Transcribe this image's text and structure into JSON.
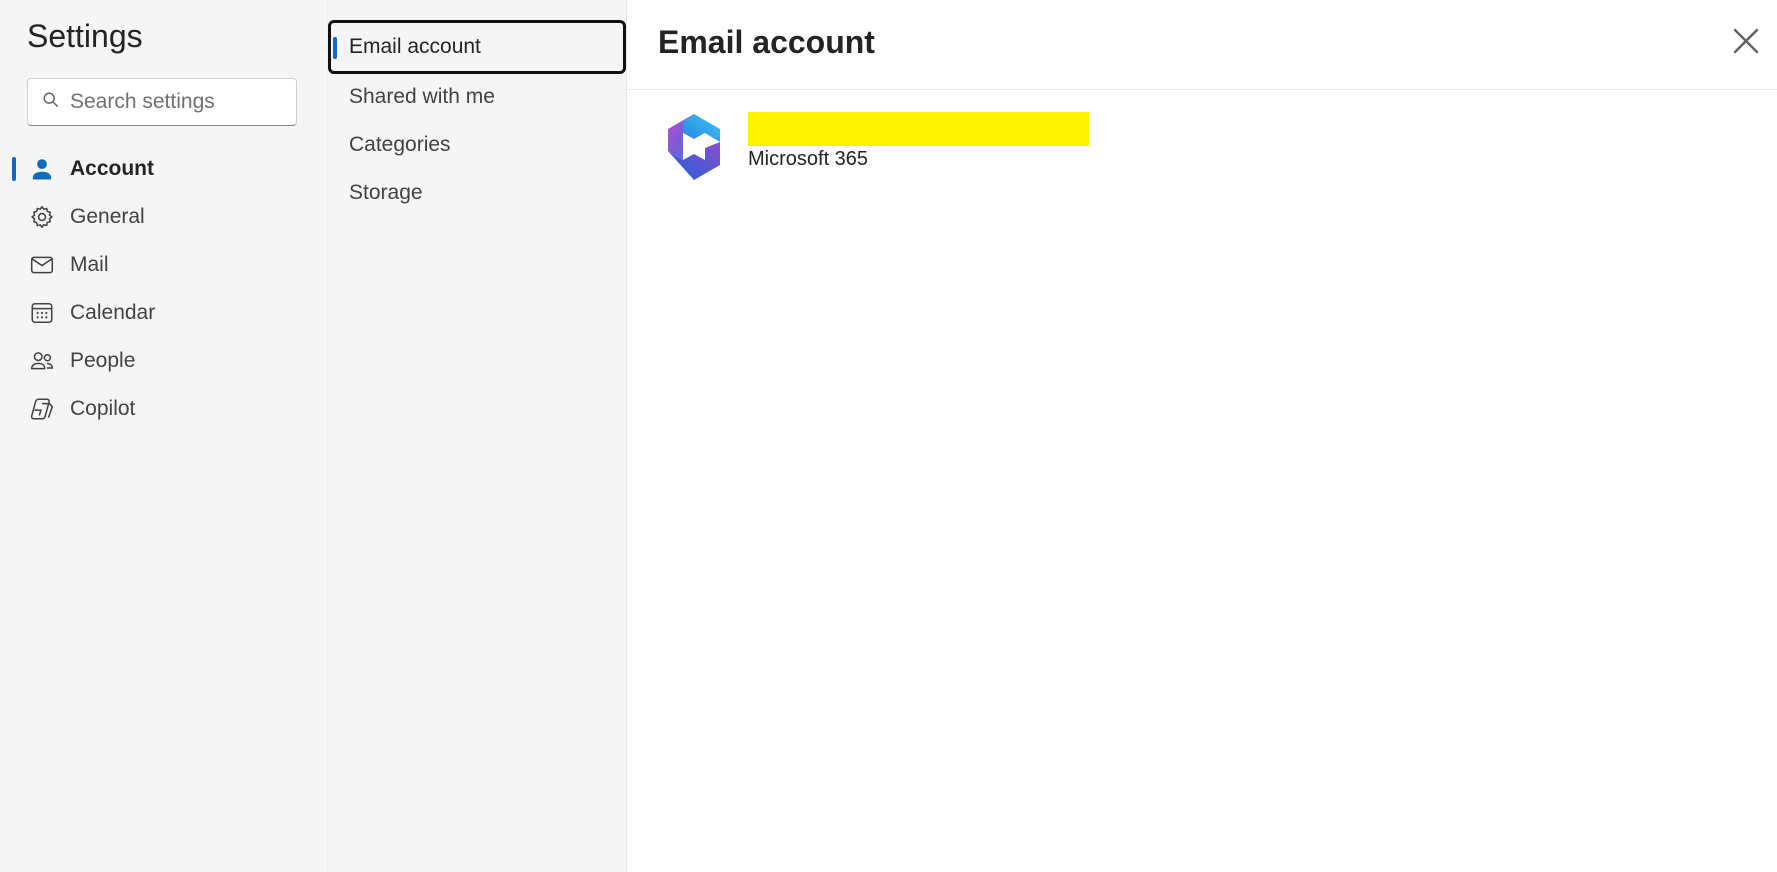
{
  "settings": {
    "title": "Settings",
    "search_placeholder": "Search settings"
  },
  "nav": {
    "items": [
      {
        "label": "Account",
        "icon": "person-icon",
        "active": true
      },
      {
        "label": "General",
        "icon": "gear-icon",
        "active": false
      },
      {
        "label": "Mail",
        "icon": "mail-icon",
        "active": false
      },
      {
        "label": "Calendar",
        "icon": "calendar-icon",
        "active": false
      },
      {
        "label": "People",
        "icon": "people-icon",
        "active": false
      },
      {
        "label": "Copilot",
        "icon": "copilot-icon",
        "active": false
      }
    ]
  },
  "subnav": {
    "items": [
      {
        "label": "Email account",
        "active": true
      },
      {
        "label": "Shared with me",
        "active": false
      },
      {
        "label": "Categories",
        "active": false
      },
      {
        "label": "Storage",
        "active": false
      }
    ]
  },
  "panel": {
    "title": "Email account",
    "account": {
      "type": "Microsoft 365",
      "logo": "microsoft-365-logo"
    }
  },
  "colors": {
    "accent": "#0f6cbd",
    "redaction": "#fff200",
    "background_pane": "#f5f5f5"
  }
}
